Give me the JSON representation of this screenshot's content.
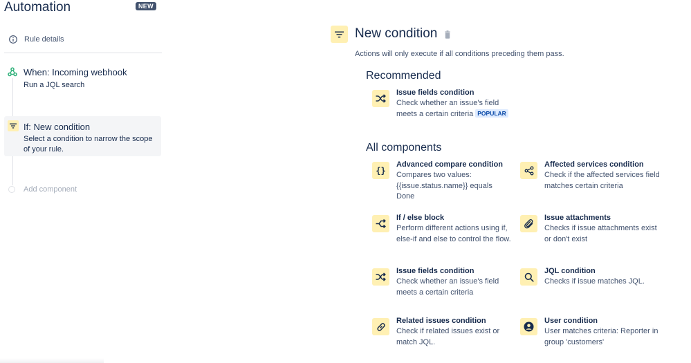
{
  "app": {
    "title": "Automation",
    "badge": "NEW"
  },
  "sidebar": {
    "rule_details": "Rule details",
    "trigger": {
      "title": "When: Incoming webhook",
      "subtitle": "Run a JQL search"
    },
    "condition": {
      "title": "If: New condition",
      "subtitle_line1": "Select a condition to narrow the scope",
      "subtitle_line2": "of your rule."
    },
    "add_component": "Add component"
  },
  "panel": {
    "title": "New condition",
    "description": "Actions will only execute if all conditions preceding them pass.",
    "recommended_title": "Recommended",
    "recommended": {
      "title": "Issue fields condition",
      "desc_line1": "Check whether an issue's field",
      "desc_line2": "meets a certain criteria",
      "badge": "POPULAR",
      "icon": "shuffle-icon"
    },
    "all_title": "All components",
    "components": [
      {
        "title": "Advanced compare condition",
        "desc": "Compares two values: {{issue.status.name}} equals Done",
        "icon": "braces-icon"
      },
      {
        "title": "Affected services condition",
        "desc": "Check if the affected services field matches certain criteria",
        "icon": "share-nodes-icon"
      },
      {
        "title": "If / else block",
        "desc": "Perform different actions using if, else-if and else to control the flow.",
        "icon": "branch-icon"
      },
      {
        "title": "Issue attachments",
        "desc": "Checks if issue attachments exist or don't exist",
        "icon": "paperclip-icon"
      },
      {
        "title": "Issue fields condition",
        "desc": "Check whether an issue's field meets a certain criteria",
        "icon": "shuffle-icon"
      },
      {
        "title": "JQL condition",
        "desc": "Checks if issue matches JQL.",
        "icon": "search-icon"
      },
      {
        "title": "Related issues condition",
        "desc": "Check if related issues exist or match JQL.",
        "icon": "link-icon"
      },
      {
        "title": "User condition",
        "desc": "User matches criteria: Reporter in group 'customers'",
        "icon": "user-icon"
      }
    ]
  },
  "colors": {
    "icon_bg": "#fff0b3",
    "text": "#172b4d",
    "subtle": "#42526e",
    "webhook": "#36b37e",
    "badge_bg": "#42526e"
  }
}
